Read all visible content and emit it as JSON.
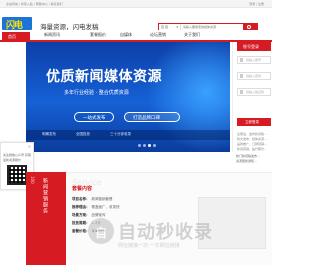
{
  "topbar": {
    "links": "全站导航 | 商家入驻 | 帮助中心 | 联系我们",
    "right": "登录 | 注册"
  },
  "header": {
    "logo_text": "闪电",
    "slogan": "海量资源，闪电发稿",
    "search": {
      "category": "百 目",
      "placeholder": "请输入要搜索的媒体资源"
    }
  },
  "nav": {
    "home": "首页",
    "items": [
      "新闻资讯",
      "套餐报价",
      "自媒体",
      "论坛营销",
      "关于我们"
    ],
    "login_tab": "账号登录"
  },
  "banner": {
    "headline": "优质新闻媒体资源",
    "subline": "多年行业经验 · 整合优质资源",
    "btn1": "一站式发布",
    "btn2": "打造品牌口碑",
    "strip": [
      "明确发布",
      "全国投放",
      "三十分钟收录"
    ],
    "active_slide": 2,
    "slide_count": 4
  },
  "login_panel": {
    "user_placeholder": "请输入账号",
    "pass_placeholder": "请输入密码",
    "code_placeholder": "请输入验证码",
    "submit": "立即登录",
    "notice": [
      "注册后，发布新闻稿...",
      "软文发布，媒体资源...",
      "品牌推广，口碑营销...",
      "新闻营销，提升曝光..."
    ]
  },
  "news": {
    "line1": "热门新闻稿发布...",
    "line2": "资源更新通知..."
  },
  "float": {
    "text": "关注微信公众号 获取最新资源报价",
    "close": "×"
  },
  "service": {
    "side_label": "新闻营销服务",
    "side_num": "100",
    "eng": "Service",
    "title": "套餐内容",
    "rows": [
      {
        "label": "项目名称：",
        "value": "新闻营销套餐"
      },
      {
        "label": "推荐理由：",
        "value": "覆盖面广，收录快"
      },
      {
        "label": "场景方案：",
        "value": "品牌宣传"
      },
      {
        "label": "投放周期：",
        "value": "1-3天"
      },
      {
        "label": "套餐价格：",
        "value": "￥4000",
        "price": true
      }
    ]
  },
  "watermark": {
    "mark": "自",
    "text": "自动秒收录",
    "sub": "网址链接一次·一次网址链接"
  }
}
